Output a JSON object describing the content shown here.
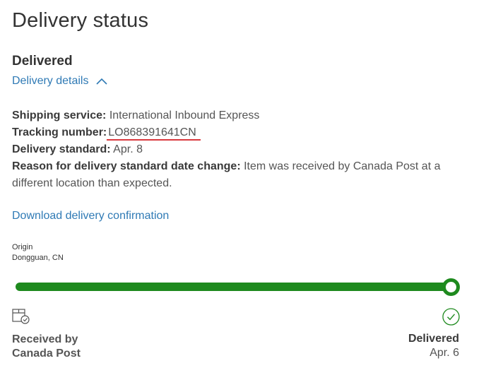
{
  "page": {
    "title": "Delivery status"
  },
  "status": {
    "heading": "Delivered",
    "details_toggle_label": "Delivery details",
    "details_expanded": true
  },
  "details": {
    "shipping_service_label": "Shipping service:",
    "shipping_service_value": "International Inbound Express",
    "tracking_number_label": "Tracking number:",
    "tracking_number_value": "LO868391641CN",
    "delivery_standard_label": "Delivery standard:",
    "delivery_standard_value": "Apr. 8",
    "reason_label": "Reason for delivery standard date change:",
    "reason_value": "Item was received by Canada Post at a different location than expected."
  },
  "download_link": "Download delivery confirmation",
  "origin": {
    "label": "Origin",
    "value": "Dongguan, CN"
  },
  "progress": {
    "fraction_complete": 1.0,
    "color": "#1e8a1e",
    "start": {
      "icon": "package-received-icon",
      "label": "Received by Canada Post"
    },
    "end": {
      "icon": "check-circle-icon",
      "label": "Delivered",
      "date": "Apr. 6"
    }
  },
  "colors": {
    "link": "#2f7ab5",
    "highlight_underline": "#d9393e",
    "success": "#1e8a1e"
  }
}
